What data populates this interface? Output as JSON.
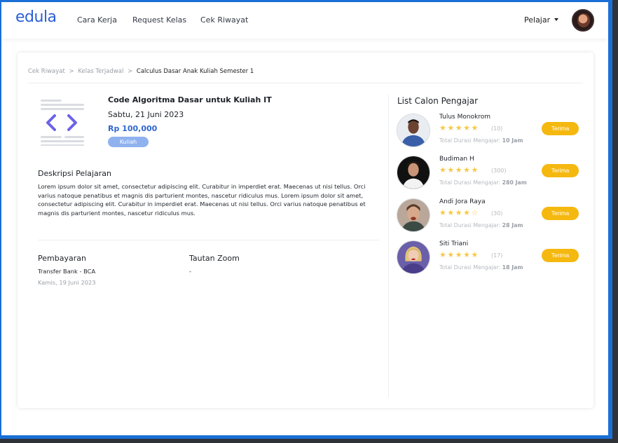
{
  "brand": {
    "logo": "edula",
    "accent": "#2c5fd6",
    "button_color": "#f5b80f",
    "badge_color": "#8fb2ef"
  },
  "nav": {
    "links": [
      "Cara Kerja",
      "Request Kelas",
      "Cek Riwayat"
    ],
    "role_label": "Pelajar"
  },
  "breadcrumb": {
    "items": [
      "Cek Riwayat",
      "Kelas Terjadwal",
      "Calculus Dasar Anak Kuliah Semester 1"
    ],
    "separator": ">"
  },
  "course": {
    "icon": "code-icon",
    "title": "Code Algoritma Dasar untuk Kuliah IT",
    "date": "Sabtu, 21 Juni 2023",
    "price": "Rp 100,000",
    "badge": "Kuliah"
  },
  "description": {
    "title": "Deskripsi Pelajaran",
    "text": "Lorem ipsum dolor sit amet, consectetur adipiscing elit. Curabitur in imperdiet erat. Maecenas ut nisi tellus. Orci varius natoque penatibus et magnis dis parturient montes, nascetur ridiculus mus. Lorem ipsum dolor sit amet, consectetur adipiscing elit. Curabitur in imperdiet erat. Maecenas ut nisi tellus. Orci varius natoque penatibus et magnis dis parturient montes, nascetur ridiculus mus."
  },
  "payment": {
    "title": "Pembayaran",
    "method": "Transfer Bank - BCA",
    "date": "Kamis, 19 Juni 2023"
  },
  "zoom": {
    "title": "Tautan Zoom",
    "value": "-"
  },
  "teachers": {
    "title": "List Calon Pengajar",
    "duration_prefix": "Total Durasi Mengajar:",
    "items": [
      {
        "name": "Tulus Monokrom",
        "stars": "★★★★★",
        "rating": 5,
        "count": "(10)",
        "duration": "10 Jam",
        "button": "Terima"
      },
      {
        "name": "Budiman H",
        "stars": "★★★★★",
        "rating": 5,
        "count": "(300)",
        "duration": "280 Jam",
        "button": "Terima"
      },
      {
        "name": "Andi Jora Raya",
        "stars": "★★★★☆",
        "rating": 4.5,
        "count": "(30)",
        "duration": "28 Jam",
        "button": "Terima"
      },
      {
        "name": "Siti Triani",
        "stars": "★★★★★",
        "rating": 5,
        "count": "(17)",
        "duration": "18 Jam",
        "button": "Terima"
      }
    ]
  }
}
